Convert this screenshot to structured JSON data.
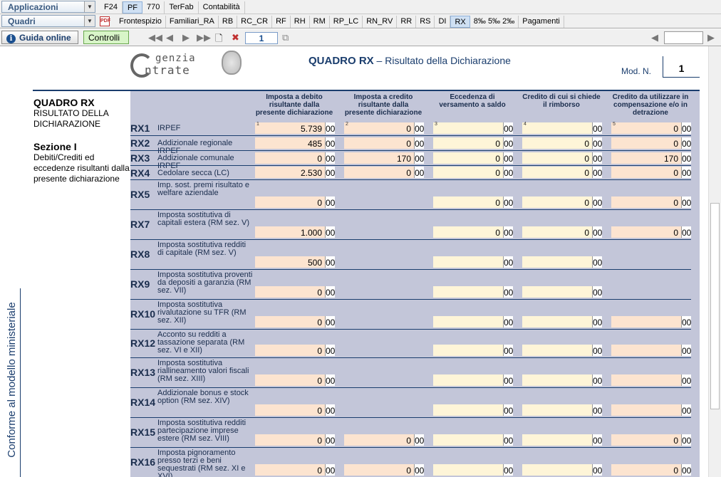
{
  "menu": {
    "applicazioni_label": "Applicazioni",
    "quadri_label": "Quadri",
    "dropdown_glyph": "▼",
    "top_tabs": [
      "F24",
      "PF",
      "770",
      "TerFab",
      "Contabilità"
    ],
    "selected_top_tab": "PF",
    "quadri_tabs": [
      "Frontespizio",
      "Familiari_RA",
      "RB",
      "RC_CR",
      "RF",
      "RH",
      "RM",
      "RP_LC",
      "RN_RV",
      "RR",
      "RS",
      "DI",
      "RX",
      "8‰ 5‰ 2‰",
      "Pagamenti"
    ],
    "selected_quadri_tab": "RX",
    "pdf_icon_text": "PDF"
  },
  "toolbar": {
    "guida_label": "Guida online",
    "guida_icon_glyph": "i",
    "controlli_label": "Controlli",
    "page_number": "1",
    "nav_first": "◀◀",
    "nav_prev": "◀",
    "nav_next": "▶",
    "nav_last": "▶▶",
    "new_page_glyph": "🗋",
    "delete_glyph": "✖",
    "copy_glyph": "⧉",
    "nav_small_prev": "◀",
    "nav_small_next": "▶"
  },
  "header": {
    "logo_line1": "genzia",
    "logo_line2": "ntrate",
    "title_bold": "QUADRO RX",
    "title_rest": " – Risultato della Dichiarazione",
    "mod_label": "Mod. N.",
    "mod_value": "1"
  },
  "side": {
    "quadro": "QUADRO RX",
    "quadro_sub": "RISULTATO DELLA DICHIARAZIONE",
    "sezione": "Sezione I",
    "sezione_sub": "Debiti/Crediti ed eccedenze risultanti dalla presente dichiarazione",
    "vertical_text": "Conforme al modello ministeriale"
  },
  "columns": [
    {
      "num": "1",
      "label": "Imposta a debito risultante dalla presente dichiarazione"
    },
    {
      "num": "2",
      "label": "Imposta a credito risultante dalla presente dichiarazione"
    },
    {
      "num": "3",
      "label": "Eccedenza di versamento a saldo"
    },
    {
      "num": "4",
      "label": "Credito di cui si chiede il rimborso"
    },
    {
      "num": "5",
      "label": "Credito da utilizzare in compensazione e/o in detrazione"
    }
  ],
  "rows": [
    {
      "code": "RX1",
      "desc": "IRPEF",
      "v": [
        "5.739",
        "0",
        "",
        "",
        "0"
      ],
      "d": [
        "00",
        "00",
        "00",
        "00",
        "00"
      ]
    },
    {
      "code": "RX2",
      "desc": "Addizionale regionale IRPEF",
      "v": [
        "485",
        "0",
        "0",
        "0",
        "0"
      ],
      "d": [
        "00",
        "00",
        "00",
        "00",
        "00"
      ]
    },
    {
      "code": "RX3",
      "desc": "Addizionale comunale IRPEF",
      "v": [
        "0",
        "170",
        "0",
        "0",
        "170"
      ],
      "d": [
        "00",
        "00",
        "00",
        "00",
        "00"
      ]
    },
    {
      "code": "RX4",
      "desc": "Cedolare secca (LC)",
      "v": [
        "2.530",
        "0",
        "0",
        "0",
        "0"
      ],
      "d": [
        "00",
        "00",
        "00",
        "00",
        "00"
      ]
    },
    {
      "code": "RX5",
      "desc": "Imp. sost. premi risultato e welfare aziendale",
      "v": [
        "0",
        null,
        "0",
        "0",
        "0"
      ],
      "d": [
        "00",
        null,
        "00",
        "00",
        "00"
      ]
    },
    {
      "code": "RX7",
      "desc": "Imposta sostitutiva di capitali estera (RM sez. V)",
      "v": [
        "1.000",
        null,
        "0",
        "0",
        "0"
      ],
      "d": [
        "00",
        null,
        "00",
        "00",
        "00"
      ]
    },
    {
      "code": "RX8",
      "desc": "Imposta sostitutiva redditi di capitale (RM sez. V)",
      "v": [
        "500",
        null,
        "",
        "",
        null
      ],
      "d": [
        "00",
        null,
        "00",
        "00",
        null
      ]
    },
    {
      "code": "RX9",
      "desc": "Imposta sostitutiva proventi da depositi a garanzia (RM sez. VII)",
      "v": [
        "0",
        null,
        "",
        "",
        null
      ],
      "d": [
        "00",
        null,
        "00",
        "00",
        null
      ]
    },
    {
      "code": "RX10",
      "desc": "Imposta sostitutiva rivalutazione su TFR (RM sez. XII)",
      "v": [
        "0",
        null,
        "",
        "",
        ""
      ],
      "d": [
        "00",
        null,
        "00",
        "00",
        "00"
      ]
    },
    {
      "code": "RX12",
      "desc": "Acconto su redditi a tassazione separata (RM sez. VI e XII)",
      "v": [
        "0",
        null,
        "",
        "",
        ""
      ],
      "d": [
        "00",
        null,
        "00",
        "00",
        "00"
      ]
    },
    {
      "code": "RX13",
      "desc": "Imposta sostitutiva riallineamento valori fiscali (RM sez. XIII)",
      "v": [
        "0",
        null,
        "",
        "",
        ""
      ],
      "d": [
        "00",
        null,
        "00",
        "00",
        "00"
      ]
    },
    {
      "code": "RX14",
      "desc": "Addizionale bonus e stock option (RM sez. XIV)",
      "v": [
        "0",
        null,
        "",
        "",
        ""
      ],
      "d": [
        "00",
        null,
        "00",
        "00",
        "00"
      ]
    },
    {
      "code": "RX15",
      "desc": "Imposta sostitutiva redditi partecipazione imprese estere (RM sez. VIII)",
      "v": [
        "0",
        "0",
        "",
        "",
        "0"
      ],
      "d": [
        "00",
        "00",
        "00",
        "00",
        "00"
      ]
    },
    {
      "code": "RX16",
      "desc": "Imposta pignoramento presso terzi e beni sequestrati (RM sez. XI e XVI)",
      "v": [
        "0",
        "0",
        "",
        "",
        "0"
      ],
      "d": [
        "00",
        "00",
        "00",
        "00",
        "00"
      ]
    }
  ]
}
